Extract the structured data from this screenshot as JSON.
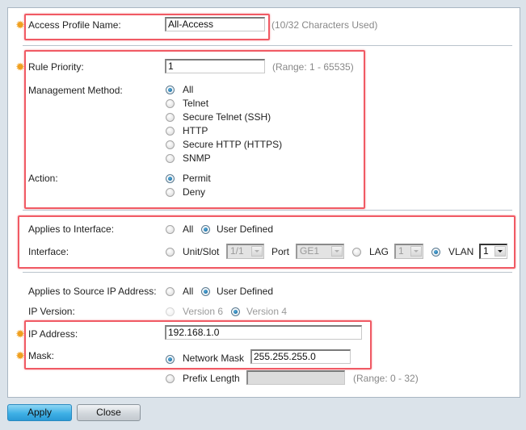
{
  "form": {
    "access_profile_name": {
      "label": "Access Profile Name:",
      "value": "All-Access",
      "hint": "(10/32 Characters Used)",
      "required": true
    },
    "rule_priority": {
      "label": "Rule Priority:",
      "value": "1",
      "hint": "(Range: 1 - 65535)",
      "required": true
    },
    "management_method": {
      "label": "Management Method:",
      "options": [
        "All",
        "Telnet",
        "Secure Telnet (SSH)",
        "HTTP",
        "Secure HTTP (HTTPS)",
        "SNMP"
      ],
      "selected": "All"
    },
    "action": {
      "label": "Action:",
      "options": [
        "Permit",
        "Deny"
      ],
      "selected": "Permit"
    },
    "applies_to_interface": {
      "label": "Applies to Interface:",
      "options": [
        "All",
        "User Defined"
      ],
      "selected": "User Defined"
    },
    "interface": {
      "label": "Interface:",
      "unit_slot_label": "Unit/Slot",
      "unit_slot_value": "1/1",
      "port_label": "Port",
      "port_value": "GE1",
      "lag_label": "LAG",
      "lag_value": "1",
      "vlan_label": "VLAN",
      "vlan_value": "1",
      "selected": "VLAN"
    },
    "applies_to_source_ip": {
      "label": "Applies to Source IP Address:",
      "options": [
        "All",
        "User Defined"
      ],
      "selected": "User Defined"
    },
    "ip_version": {
      "label": "IP Version:",
      "options": [
        "Version 6",
        "Version 4"
      ],
      "selected": "Version 4"
    },
    "ip_address": {
      "label": "IP Address:",
      "value": "192.168.1.0",
      "required": true
    },
    "mask": {
      "label": "Mask:",
      "network_mask_label": "Network Mask",
      "network_mask_value": "255.255.255.0",
      "prefix_length_label": "Prefix Length",
      "prefix_length_value": "",
      "prefix_hint": "(Range: 0 - 32)",
      "selected": "Network Mask",
      "required": true
    }
  },
  "buttons": {
    "apply": "Apply",
    "close": "Close"
  },
  "icons": {
    "required": "required-star-icon"
  },
  "colors": {
    "highlight": "#f05a64",
    "required": "#f0a020",
    "apply_button": "#3fb0e6",
    "background": "#dbe3ea"
  }
}
